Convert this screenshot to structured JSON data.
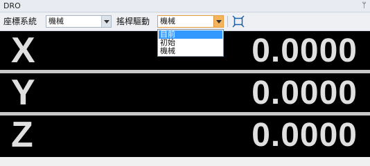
{
  "panel": {
    "title": "DRO",
    "pin_icon": "pin-icon"
  },
  "toolbar": {
    "coord_label": "座標系統",
    "coord_value": "機械",
    "drive_label": "搖桿驅動",
    "drive_value": "機械",
    "fit_icon": "fit-view-icon",
    "accent_color": "#f6b35d"
  },
  "dropdown": {
    "options": [
      "目前",
      "初始",
      "機械"
    ],
    "highlighted": "目前",
    "highlight_color": "#3399ff"
  },
  "axes": [
    {
      "name": "X",
      "value": "0.0000"
    },
    {
      "name": "Y",
      "value": "0.0000"
    },
    {
      "name": "Z",
      "value": "0.0000"
    }
  ]
}
